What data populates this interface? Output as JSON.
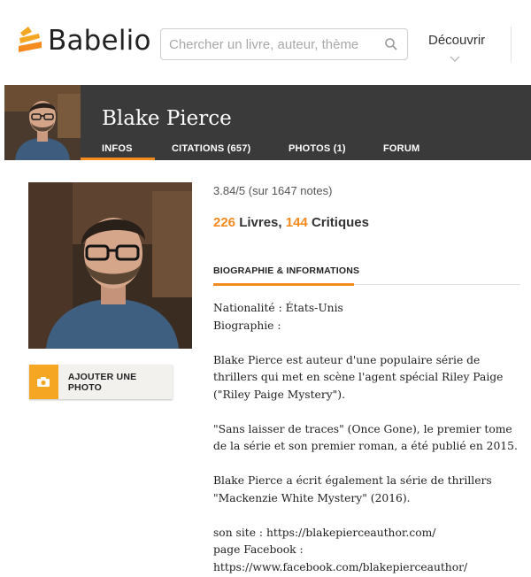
{
  "header": {
    "logo_text": "Babelio",
    "search_placeholder": "Chercher un livre, auteur, thème",
    "discover_label": "Découvrir"
  },
  "author": {
    "name": "Blake Pierce",
    "tabs": [
      {
        "label": "INFOS",
        "active": true
      },
      {
        "label": "CITATIONS (657)",
        "active": false
      },
      {
        "label": "PHOTOS (1)",
        "active": false
      },
      {
        "label": "FORUM",
        "active": false
      }
    ]
  },
  "sidebar": {
    "add_photo_label": "AJOUTER UNE PHOTO"
  },
  "stats": {
    "rating": "3.84/5 (sur 1647 notes)",
    "books_count": "226",
    "books_label": "Livres,",
    "reviews_count": "144",
    "reviews_label": "Critiques"
  },
  "bio": {
    "section_title": "BIOGRAPHIE & INFORMATIONS",
    "nationality": "Nationalité : États-Unis",
    "biographie_label": "Biographie :",
    "para1": "Blake Pierce est auteur d'une populaire série de thrillers qui met en scène l'agent spécial Riley Paige (\"Riley Paige Mystery\").",
    "para2": "\"Sans laisser de traces\" (Once Gone), le premier tome de la série et son premier roman, a été publié en 2015.",
    "para3": "Blake Pierce a écrit également la série de thrillers \"Mackenzie White Mystery\" (2016).",
    "site": "son site : https://blakepierceauthor.com/",
    "facebook_label": "page Facebook :",
    "facebook_url": "https://www.facebook.com/blakepierceauthor/"
  },
  "colors": {
    "accent": "#f58a1f",
    "band": "#3a3a3a",
    "camera_box": "#f5a623"
  }
}
